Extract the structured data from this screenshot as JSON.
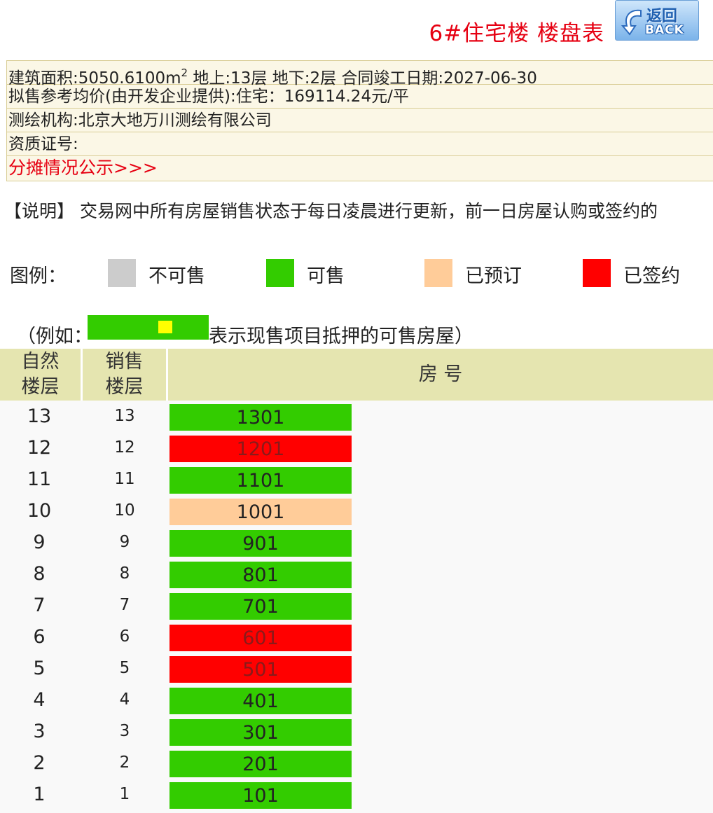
{
  "header": {
    "title": "6#住宅楼 楼盘表",
    "back_cn": "返回",
    "back_en": "BACK"
  },
  "info": {
    "area_prefix": "建筑面积:5050.6100m",
    "area_sup": "2",
    "area_suffix": " 地上:13层 地下:2层 合同竣工日期:2027-06-30",
    "price": "拟售参考均价(由开发企业提供):住宅：169114.24元/平",
    "survey": "测绘机构:北京大地万川测绘有限公司",
    "cert": "资质证号:",
    "share_link": "分摊情况公示>>>"
  },
  "note": "【说明】 交易网中所有房屋销售状态于每日凌晨进行更新，前一日房屋认购或签约的",
  "legend": {
    "label": "图例：",
    "items": [
      {
        "label": "不可售",
        "color": "#cccccc"
      },
      {
        "label": "可售",
        "color": "#33cc00"
      },
      {
        "label": "已预订",
        "color": "#ffcc99"
      },
      {
        "label": "已签约",
        "color": "#ff0000"
      }
    ]
  },
  "example": {
    "prefix": "（例如：",
    "suffix": "表示现售项目抵押的可售房屋）",
    "bar_color": "#33cc00",
    "mark_color": "#ffff00"
  },
  "table": {
    "headers": {
      "natural_line1": "自然",
      "natural_line2": "楼层",
      "sale_line1": "销售",
      "sale_line2": "楼层",
      "room": "房 号"
    },
    "rows": [
      {
        "natural": "13",
        "sale": "13",
        "room": "1301",
        "status": "可售",
        "color": "#33cc00"
      },
      {
        "natural": "12",
        "sale": "12",
        "room": "1201",
        "status": "已签约",
        "color": "#ff0000"
      },
      {
        "natural": "11",
        "sale": "11",
        "room": "1101",
        "status": "可售",
        "color": "#33cc00"
      },
      {
        "natural": "10",
        "sale": "10",
        "room": "1001",
        "status": "已预订",
        "color": "#ffcc99"
      },
      {
        "natural": "9",
        "sale": "9",
        "room": "901",
        "status": "可售",
        "color": "#33cc00"
      },
      {
        "natural": "8",
        "sale": "8",
        "room": "801",
        "status": "可售",
        "color": "#33cc00"
      },
      {
        "natural": "7",
        "sale": "7",
        "room": "701",
        "status": "可售",
        "color": "#33cc00"
      },
      {
        "natural": "6",
        "sale": "6",
        "room": "601",
        "status": "已签约",
        "color": "#ff0000"
      },
      {
        "natural": "5",
        "sale": "5",
        "room": "501",
        "status": "已签约",
        "color": "#ff0000"
      },
      {
        "natural": "4",
        "sale": "4",
        "room": "401",
        "status": "可售",
        "color": "#33cc00"
      },
      {
        "natural": "3",
        "sale": "3",
        "room": "301",
        "status": "可售",
        "color": "#33cc00"
      },
      {
        "natural": "2",
        "sale": "2",
        "room": "201",
        "status": "可售",
        "color": "#33cc00"
      },
      {
        "natural": "1",
        "sale": "1",
        "room": "101",
        "status": "可售",
        "color": "#33cc00"
      }
    ]
  }
}
